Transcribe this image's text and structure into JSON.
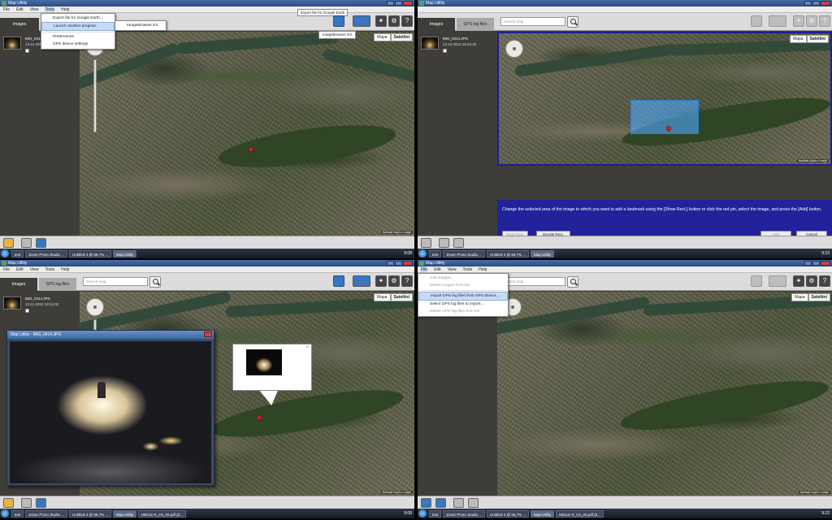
{
  "q1": {
    "title": "Map Utility",
    "menu": [
      "File",
      "Edit",
      "View",
      "Tools",
      "Help"
    ],
    "tabs": {
      "images": "Images"
    },
    "image": {
      "name": "IMG_0414.JPG",
      "date": "13.12.2012 18:44:32"
    },
    "tools_menu": [
      "Export file for Google Earth...",
      "Launch another program",
      "Preferences",
      "GPS device settings"
    ],
    "submenu": [
      "ImageBrowser EX"
    ],
    "tooltip1": "Export file for Google Earth",
    "tooltip2": "ImageBrowser EX",
    "maptype": [
      "Mapa",
      "Satelitní"
    ],
    "credit": "Nahlásit chybu v mapě",
    "taskbar": [
      "test",
      "Zoner Photo Studio ...",
      "Untitled-3 @ 66,7% ...",
      "Map Utility"
    ],
    "clock": "9:08"
  },
  "q2": {
    "title": "Map Utility",
    "tabs": {
      "images": "Images",
      "gps": "GPS log files"
    },
    "image": {
      "name": "IMG_0414.JPG",
      "date": "13.12.2012 18:44:32"
    },
    "search_placeholder": "Search map",
    "maptype": [
      "Mapa",
      "Satelitní"
    ],
    "credit": "Nahlásit chybu v mapě",
    "message": "Change the selected area of the image to which you want to add a landmark using the [Show Rect.] button or click the red pin, select the image, and press the [Add] button.",
    "buttons": {
      "show_rect": "Show Rect.",
      "decide_rect": "Decide Rect.",
      "add": "Add",
      "cancel": "Cancel"
    },
    "taskbar": [
      "test",
      "Zoner Photo Studio ...",
      "Untitled-3 @ 66,7% ...",
      "Map Utility"
    ],
    "clock": "9:23"
  },
  "q3": {
    "title": "Map Utility",
    "menu": [
      "File",
      "Edit",
      "View",
      "Tools",
      "Help"
    ],
    "tabs": {
      "images": "Images",
      "gps": "GPS log files"
    },
    "image": {
      "name": "IMG_0414.JPG",
      "date": "13.12.2012 18:44:32"
    },
    "search_placeholder": "Search map",
    "photo_title": "Map Utility - IMG_0414.JPG",
    "maptype": [
      "Mapa",
      "Satelitní"
    ],
    "credit": "Nahlásit chybu v mapě",
    "taskbar": [
      "test",
      "Zoner Photo Studio ...",
      "Untitled-3 @ 66,7% ...",
      "Map Utility",
      "MIGLE-K_C5_00.pdf (Z..."
    ],
    "clock": "9:08"
  },
  "q4": {
    "title": "Map Utility",
    "menu": [
      "File",
      "Edit",
      "View",
      "Tools",
      "Help"
    ],
    "file_menu": [
      "Add images...",
      "Delete images from list",
      "Import GPS log files from GPS device...",
      "Select GPS log files to import...",
      "Delete GPS log files from list"
    ],
    "search_placeholder": "Search map",
    "maptype": [
      "Mapa",
      "Satelitní"
    ],
    "credit": "Nahlásit chybu v mapě",
    "taskbar": [
      "test",
      "Zoner Photo Studio ...",
      "Untitled-3 @ 66,7% ...",
      "Map Utility",
      "MIGLE-K_C5_00.pdf (Z..."
    ],
    "clock": "9:22"
  }
}
